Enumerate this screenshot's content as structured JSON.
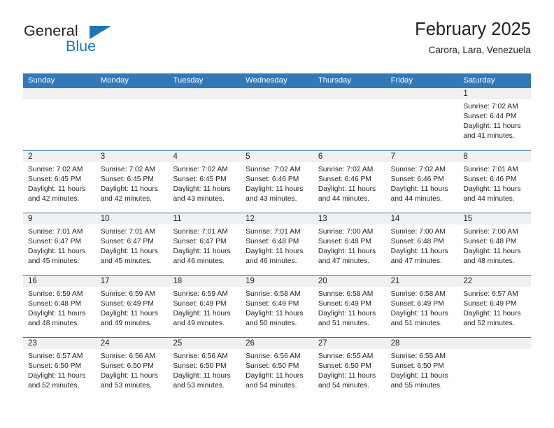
{
  "brand": {
    "name_top": "General",
    "name_bottom": "Blue",
    "triangle_icon": "brand-triangle-icon",
    "color_dark": "#231f20",
    "color_blue": "#1b75bb"
  },
  "header": {
    "title": "February 2025",
    "subtitle": "Carora, Lara, Venezuela"
  },
  "theme": {
    "header_blue": "#3179b8",
    "daynum_band": "#f0f0f0",
    "text": "#231f20"
  },
  "weekdays": [
    "Sunday",
    "Monday",
    "Tuesday",
    "Wednesday",
    "Thursday",
    "Friday",
    "Saturday"
  ],
  "labels": {
    "sunrise": "Sunrise:",
    "sunset": "Sunset:",
    "daylight": "Daylight:"
  },
  "weeks": [
    [
      {
        "empty": true
      },
      {
        "empty": true
      },
      {
        "empty": true
      },
      {
        "empty": true
      },
      {
        "empty": true
      },
      {
        "empty": true
      },
      {
        "day": "1",
        "sunrise": "Sunrise: 7:02 AM",
        "sunset": "Sunset: 6:44 PM",
        "daylight_1": "Daylight: 11 hours",
        "daylight_2": "and 41 minutes."
      }
    ],
    [
      {
        "day": "2",
        "sunrise": "Sunrise: 7:02 AM",
        "sunset": "Sunset: 6:45 PM",
        "daylight_1": "Daylight: 11 hours",
        "daylight_2": "and 42 minutes."
      },
      {
        "day": "3",
        "sunrise": "Sunrise: 7:02 AM",
        "sunset": "Sunset: 6:45 PM",
        "daylight_1": "Daylight: 11 hours",
        "daylight_2": "and 42 minutes."
      },
      {
        "day": "4",
        "sunrise": "Sunrise: 7:02 AM",
        "sunset": "Sunset: 6:45 PM",
        "daylight_1": "Daylight: 11 hours",
        "daylight_2": "and 43 minutes."
      },
      {
        "day": "5",
        "sunrise": "Sunrise: 7:02 AM",
        "sunset": "Sunset: 6:46 PM",
        "daylight_1": "Daylight: 11 hours",
        "daylight_2": "and 43 minutes."
      },
      {
        "day": "6",
        "sunrise": "Sunrise: 7:02 AM",
        "sunset": "Sunset: 6:46 PM",
        "daylight_1": "Daylight: 11 hours",
        "daylight_2": "and 44 minutes."
      },
      {
        "day": "7",
        "sunrise": "Sunrise: 7:02 AM",
        "sunset": "Sunset: 6:46 PM",
        "daylight_1": "Daylight: 11 hours",
        "daylight_2": "and 44 minutes."
      },
      {
        "day": "8",
        "sunrise": "Sunrise: 7:01 AM",
        "sunset": "Sunset: 6:46 PM",
        "daylight_1": "Daylight: 11 hours",
        "daylight_2": "and 44 minutes."
      }
    ],
    [
      {
        "day": "9",
        "sunrise": "Sunrise: 7:01 AM",
        "sunset": "Sunset: 6:47 PM",
        "daylight_1": "Daylight: 11 hours",
        "daylight_2": "and 45 minutes."
      },
      {
        "day": "10",
        "sunrise": "Sunrise: 7:01 AM",
        "sunset": "Sunset: 6:47 PM",
        "daylight_1": "Daylight: 11 hours",
        "daylight_2": "and 45 minutes."
      },
      {
        "day": "11",
        "sunrise": "Sunrise: 7:01 AM",
        "sunset": "Sunset: 6:47 PM",
        "daylight_1": "Daylight: 11 hours",
        "daylight_2": "and 46 minutes."
      },
      {
        "day": "12",
        "sunrise": "Sunrise: 7:01 AM",
        "sunset": "Sunset: 6:48 PM",
        "daylight_1": "Daylight: 11 hours",
        "daylight_2": "and 46 minutes."
      },
      {
        "day": "13",
        "sunrise": "Sunrise: 7:00 AM",
        "sunset": "Sunset: 6:48 PM",
        "daylight_1": "Daylight: 11 hours",
        "daylight_2": "and 47 minutes."
      },
      {
        "day": "14",
        "sunrise": "Sunrise: 7:00 AM",
        "sunset": "Sunset: 6:48 PM",
        "daylight_1": "Daylight: 11 hours",
        "daylight_2": "and 47 minutes."
      },
      {
        "day": "15",
        "sunrise": "Sunrise: 7:00 AM",
        "sunset": "Sunset: 6:48 PM",
        "daylight_1": "Daylight: 11 hours",
        "daylight_2": "and 48 minutes."
      }
    ],
    [
      {
        "day": "16",
        "sunrise": "Sunrise: 6:59 AM",
        "sunset": "Sunset: 6:48 PM",
        "daylight_1": "Daylight: 11 hours",
        "daylight_2": "and 48 minutes."
      },
      {
        "day": "17",
        "sunrise": "Sunrise: 6:59 AM",
        "sunset": "Sunset: 6:49 PM",
        "daylight_1": "Daylight: 11 hours",
        "daylight_2": "and 49 minutes."
      },
      {
        "day": "18",
        "sunrise": "Sunrise: 6:59 AM",
        "sunset": "Sunset: 6:49 PM",
        "daylight_1": "Daylight: 11 hours",
        "daylight_2": "and 49 minutes."
      },
      {
        "day": "19",
        "sunrise": "Sunrise: 6:58 AM",
        "sunset": "Sunset: 6:49 PM",
        "daylight_1": "Daylight: 11 hours",
        "daylight_2": "and 50 minutes."
      },
      {
        "day": "20",
        "sunrise": "Sunrise: 6:58 AM",
        "sunset": "Sunset: 6:49 PM",
        "daylight_1": "Daylight: 11 hours",
        "daylight_2": "and 51 minutes."
      },
      {
        "day": "21",
        "sunrise": "Sunrise: 6:58 AM",
        "sunset": "Sunset: 6:49 PM",
        "daylight_1": "Daylight: 11 hours",
        "daylight_2": "and 51 minutes."
      },
      {
        "day": "22",
        "sunrise": "Sunrise: 6:57 AM",
        "sunset": "Sunset: 6:49 PM",
        "daylight_1": "Daylight: 11 hours",
        "daylight_2": "and 52 minutes."
      }
    ],
    [
      {
        "day": "23",
        "sunrise": "Sunrise: 6:57 AM",
        "sunset": "Sunset: 6:50 PM",
        "daylight_1": "Daylight: 11 hours",
        "daylight_2": "and 52 minutes."
      },
      {
        "day": "24",
        "sunrise": "Sunrise: 6:56 AM",
        "sunset": "Sunset: 6:50 PM",
        "daylight_1": "Daylight: 11 hours",
        "daylight_2": "and 53 minutes."
      },
      {
        "day": "25",
        "sunrise": "Sunrise: 6:56 AM",
        "sunset": "Sunset: 6:50 PM",
        "daylight_1": "Daylight: 11 hours",
        "daylight_2": "and 53 minutes."
      },
      {
        "day": "26",
        "sunrise": "Sunrise: 6:56 AM",
        "sunset": "Sunset: 6:50 PM",
        "daylight_1": "Daylight: 11 hours",
        "daylight_2": "and 54 minutes."
      },
      {
        "day": "27",
        "sunrise": "Sunrise: 6:55 AM",
        "sunset": "Sunset: 6:50 PM",
        "daylight_1": "Daylight: 11 hours",
        "daylight_2": "and 54 minutes."
      },
      {
        "day": "28",
        "sunrise": "Sunrise: 6:55 AM",
        "sunset": "Sunset: 6:50 PM",
        "daylight_1": "Daylight: 11 hours",
        "daylight_2": "and 55 minutes."
      },
      {
        "empty": true
      }
    ]
  ]
}
